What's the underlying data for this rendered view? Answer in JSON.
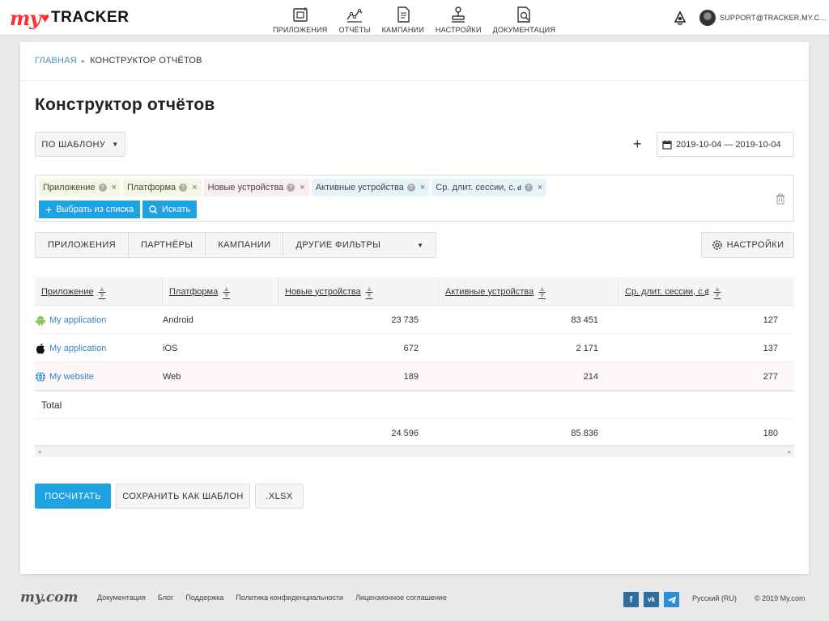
{
  "header": {
    "logo_my": "my",
    "logo_tracker": "TRACKER",
    "nav": [
      {
        "label": "ПРИЛОЖЕНИЯ",
        "icon": "apps-icon"
      },
      {
        "label": "ОТЧЁТЫ",
        "icon": "reports-icon"
      },
      {
        "label": "КАМПАНИИ",
        "icon": "campaigns-icon"
      },
      {
        "label": "НАСТРОЙКИ",
        "icon": "settings-icon"
      },
      {
        "label": "ДОКУМЕНТАЦИЯ",
        "icon": "docs-icon"
      }
    ],
    "user": "SUPPORT@TRACKER.MY.COM"
  },
  "breadcrumb": {
    "home": "ГЛАВНАЯ",
    "current": "КОНСТРУКТОР ОТЧЁТОВ"
  },
  "page_title": "Конструктор отчётов",
  "template_button": "ПО ШАБЛОНУ",
  "date_range": "2019-10-04 — 2019-10-04",
  "chips": [
    {
      "label": "Приложение",
      "sup": "",
      "color": "#f4f7e4"
    },
    {
      "label": "Платформа",
      "sup": "",
      "color": "#f4f7e4"
    },
    {
      "label": "Новые устройства",
      "sup": "",
      "color": "#fbeef0"
    },
    {
      "label": "Активные устройства",
      "sup": "",
      "color": "#e6f3fb"
    },
    {
      "label": "Ср. длит. сессии, с.",
      "sup": "d",
      "color": "#e6f3fb"
    }
  ],
  "actions": {
    "select_from_list": "Выбрать из списка",
    "search": "Искать"
  },
  "filter_tabs": [
    "ПРИЛОЖЕНИЯ",
    "ПАРТНЁРЫ",
    "КАМПАНИИ",
    "ДРУГИЕ ФИЛЬТРЫ"
  ],
  "settings_button": "НАСТРОЙКИ",
  "table": {
    "columns": [
      {
        "label": "Приложение",
        "sup": ""
      },
      {
        "label": "Платформа",
        "sup": ""
      },
      {
        "label": "Новые устройства",
        "sup": ""
      },
      {
        "label": "Активные устройства",
        "sup": ""
      },
      {
        "label": "Ср. длит. сессии, с.",
        "sup": "d"
      }
    ],
    "rows": [
      {
        "app": "My application",
        "icon": "android-icon",
        "platform": "Android",
        "new": "23 735",
        "active": "83 451",
        "session": "127"
      },
      {
        "app": "My application",
        "icon": "apple-icon",
        "platform": "iOS",
        "new": "672",
        "active": "2 171",
        "session": "137"
      },
      {
        "app": "My website",
        "icon": "globe-icon",
        "platform": "Web",
        "new": "189",
        "active": "214",
        "session": "277"
      }
    ],
    "total_label": "Total",
    "totals": {
      "new": "24 596",
      "active": "85 836",
      "session": "180"
    }
  },
  "buttons": {
    "calculate": "ПОСЧИТАТЬ",
    "save_template": "СОХРАНИТЬ КАК ШАБЛОН",
    "xlsx": ".XLSX"
  },
  "footer": {
    "logo": "my.com",
    "links": [
      "Документация",
      "Блог",
      "Поддержка",
      "Политика конфиденциальности",
      "Лицензионное соглашение"
    ],
    "social": [
      "f",
      "vk",
      "tg"
    ],
    "language": "Русский (RU)",
    "copyright": "© 2019 My.com"
  },
  "colors": {
    "accent": "#1ea2e1",
    "link": "#3584c6",
    "logo_red": "#ff2e2e"
  }
}
